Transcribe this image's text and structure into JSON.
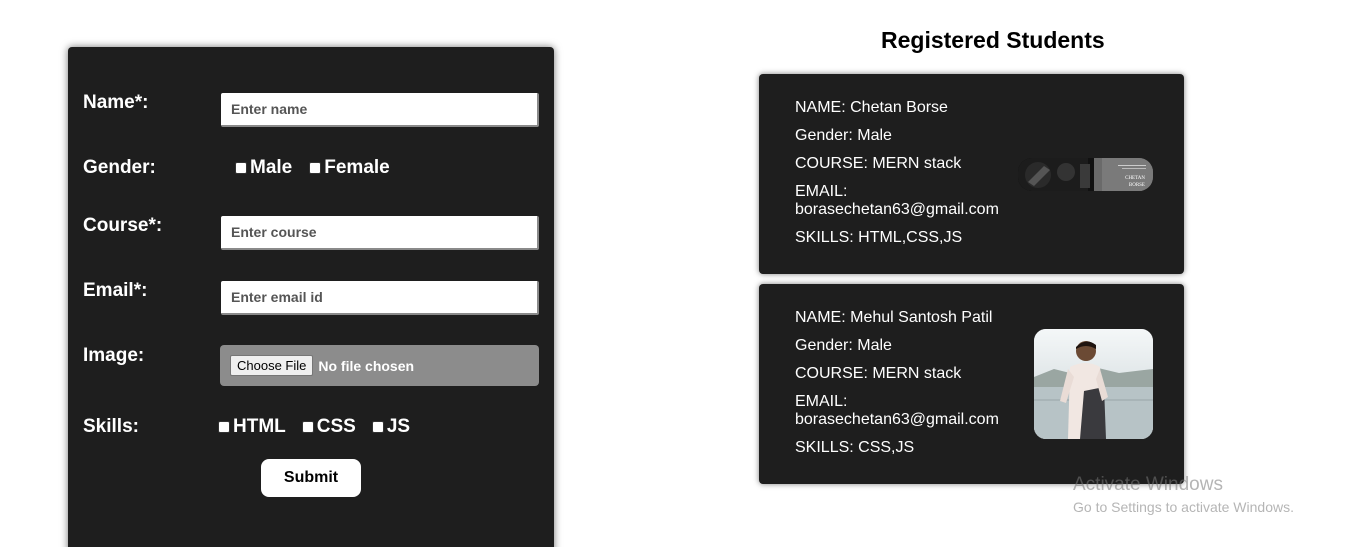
{
  "form": {
    "name_label": "Name*:",
    "name_placeholder": "Enter name",
    "gender_label": "Gender:",
    "gender_options": [
      "Male",
      "Female"
    ],
    "course_label": "Course*:",
    "course_placeholder": "Enter course",
    "email_label": "Email*:",
    "email_placeholder": "Enter email id",
    "image_label": "Image:",
    "file_button": "Choose File",
    "file_status": "No file chosen",
    "skills_label": "Skills:",
    "skills_options": [
      "HTML",
      "CSS",
      "JS"
    ],
    "submit_label": "Submit"
  },
  "students": {
    "title": "Registered Students",
    "cards": [
      {
        "name": "NAME: Chetan Borse",
        "gender": "Gender: Male",
        "course": "COURSE: MERN stack",
        "email_label": "EMAIL:",
        "email": "borasechetan63@gmail.com",
        "skills": "SKILLS: HTML,CSS,JS",
        "image_text": [
          "CHETAN",
          "BORSE"
        ]
      },
      {
        "name": "NAME: Mehul Santosh Patil",
        "gender": "Gender: Male",
        "course": "COURSE: MERN stack",
        "email_label": "EMAIL:",
        "email": "borasechetan63@gmail.com",
        "skills": "SKILLS: CSS,JS"
      }
    ]
  },
  "watermark": {
    "title": "Activate Windows",
    "subtitle": "Go to Settings to activate Windows."
  }
}
